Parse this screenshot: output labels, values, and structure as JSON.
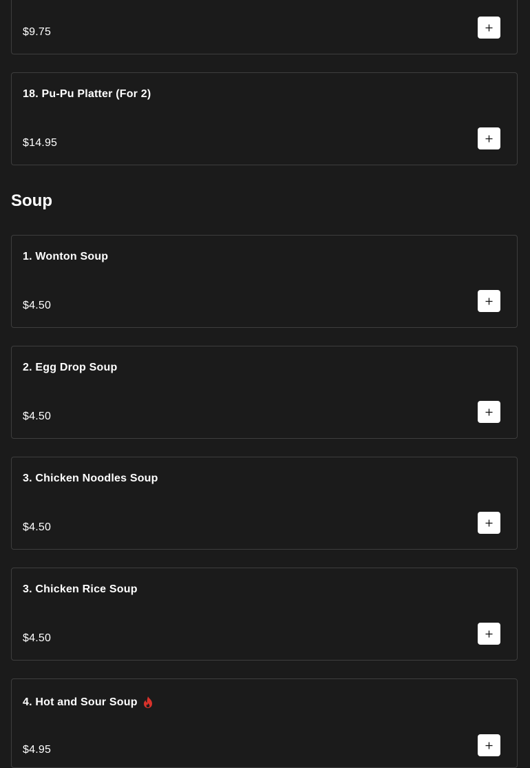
{
  "prev_items": [
    {
      "price": "$9.75",
      "add_label": "+"
    },
    {
      "name": "18. Pu-Pu Platter (For 2)",
      "price": "$14.95",
      "add_label": "+"
    }
  ],
  "soup_section": {
    "title": "Soup",
    "items": [
      {
        "name": "1. Wonton Soup",
        "price": "$4.50",
        "spicy": false
      },
      {
        "name": "2. Egg Drop Soup",
        "price": "$4.50",
        "spicy": false
      },
      {
        "name": "3. Chicken Noodles Soup",
        "price": "$4.50",
        "spicy": false
      },
      {
        "name": "3. Chicken Rice Soup",
        "price": "$4.50",
        "spicy": false
      },
      {
        "name": "4. Hot and Sour Soup",
        "price": "$4.95",
        "spicy": true,
        "spicy_icon": "flame-icon"
      }
    ]
  },
  "colors": {
    "background": "#1b1b1b",
    "card_border": "#3e3e3e",
    "text": "#ffffff",
    "button_bg": "#ffffff",
    "button_icon": "#111111",
    "spicy": "#d9322b"
  }
}
